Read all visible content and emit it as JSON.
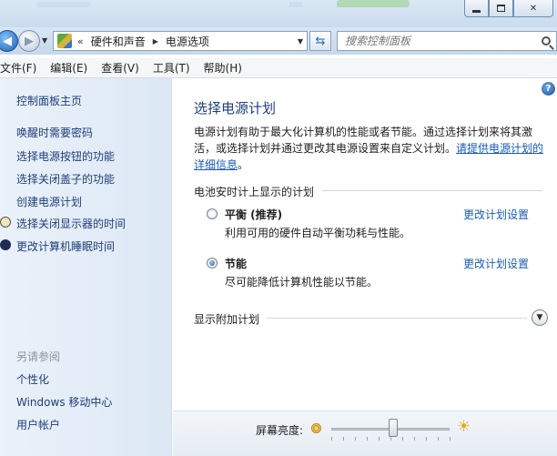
{
  "window": {
    "min_glyph": "—",
    "max_glyph": "□",
    "close_glyph": "✕"
  },
  "address": {
    "chevrons": "«",
    "breadcrumbs": [
      "硬件和声音",
      "电源选项"
    ],
    "search_placeholder": "搜索控制面板"
  },
  "menu": [
    "文件(F)",
    "编辑(E)",
    "查看(V)",
    "工具(T)",
    "帮助(H)"
  ],
  "sidebar": {
    "home": "控制面板主页",
    "tasks": [
      "唤醒时需要密码",
      "选择电源按钮的功能",
      "选择关闭盖子的功能",
      "创建电源计划",
      "选择关闭显示器的时间",
      "更改计算机睡眠时间"
    ],
    "see_also_title": "另请参阅",
    "see_also": [
      "个性化",
      "Windows 移动中心",
      "用户帐户"
    ]
  },
  "main": {
    "title": "选择电源计划",
    "desc": "电源计划有助于最大化计算机的性能或者节能。通过选择计划来将其激活，或选择计划并通过更改其电源设置来自定义计划。",
    "desc_link": "请提供电源计划的详细信息",
    "desc_end": "。",
    "section_title": "电池安时计上显示的计划",
    "plans": [
      {
        "name": "平衡 (推荐)",
        "desc": "利用可用的硬件自动平衡功耗与性能。",
        "link": "更改计划设置",
        "selected": false
      },
      {
        "name": "节能",
        "desc": "尽可能降低计算机性能以节能。",
        "link": "更改计划设置",
        "selected": true
      }
    ],
    "extra_plans": "显示附加计划",
    "help_glyph": "?"
  },
  "brightness": {
    "label": "屏幕亮度:",
    "level_percent": 52
  }
}
